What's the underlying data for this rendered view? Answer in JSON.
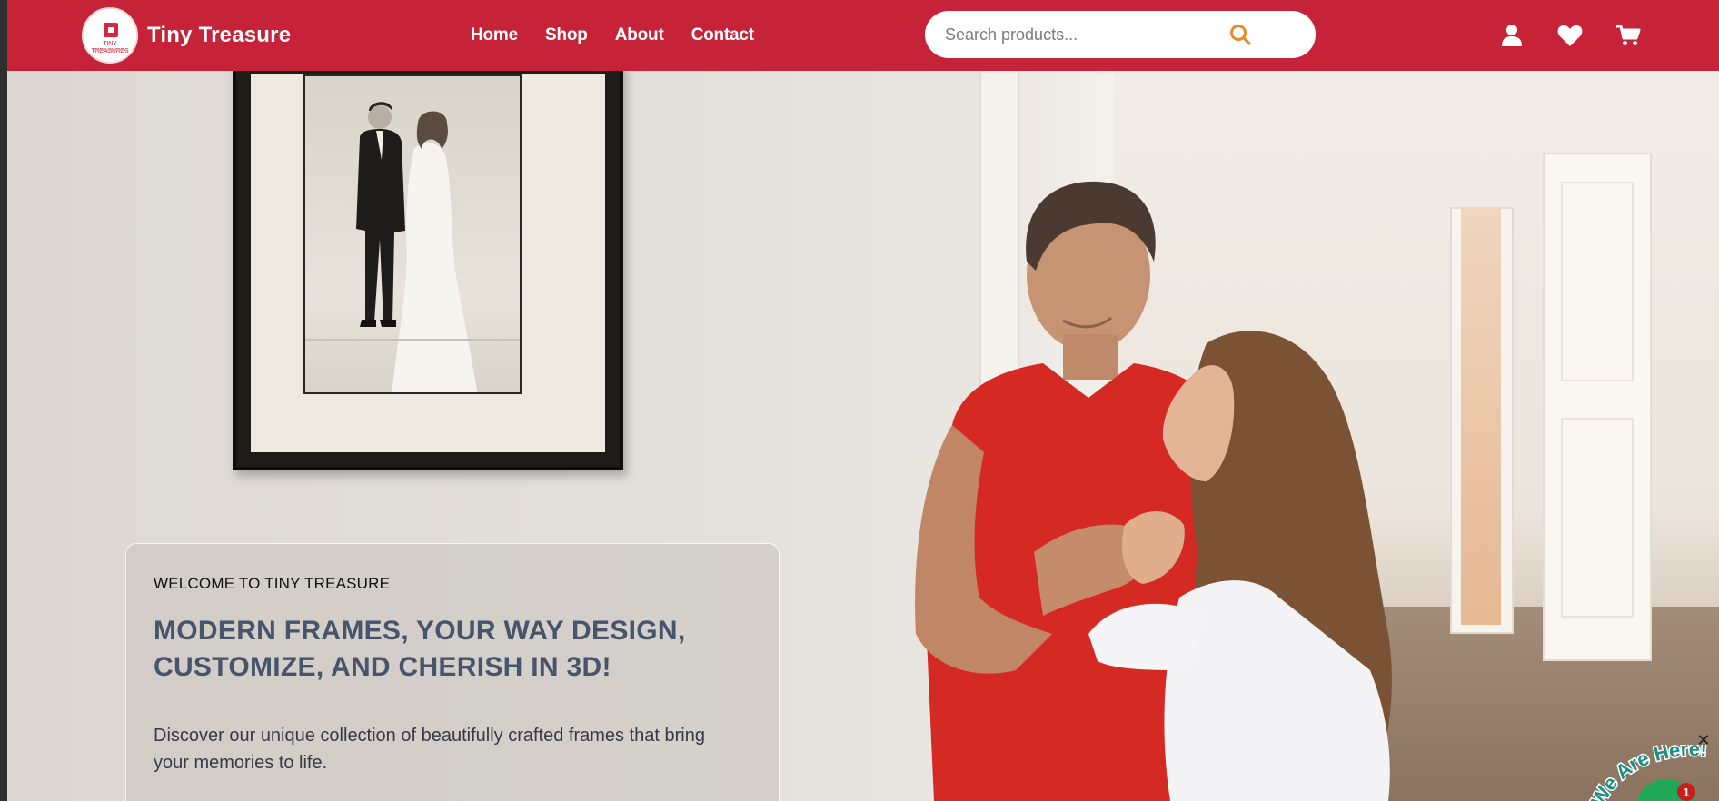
{
  "brand": {
    "name": "Tiny Treasure",
    "logo_text": "TINY TREASURES"
  },
  "nav": {
    "items": [
      {
        "label": "Home"
      },
      {
        "label": "Shop"
      },
      {
        "label": "About"
      },
      {
        "label": "Contact"
      }
    ]
  },
  "search": {
    "placeholder": "Search products...",
    "value": ""
  },
  "header_icons": [
    "user-icon",
    "heart-icon",
    "cart-icon"
  ],
  "colors": {
    "header_bg": "#c62238",
    "search_icon": "#e8892b",
    "hero_title": "#46546c",
    "chat_green": "#1fa855",
    "badge_red": "#c81e1e"
  },
  "hero": {
    "eyebrow": "WELCOME TO TINY TREASURE",
    "title": "MODERN FRAMES, YOUR WAY DESIGN, CUSTOMIZE, AND CHERISH IN 3D!",
    "description": "Discover our unique collection of beautifully crafted frames that bring your memories to life."
  },
  "chat": {
    "close_label": "✕",
    "banner_text": "We Are Here!",
    "badge_count": "1"
  }
}
